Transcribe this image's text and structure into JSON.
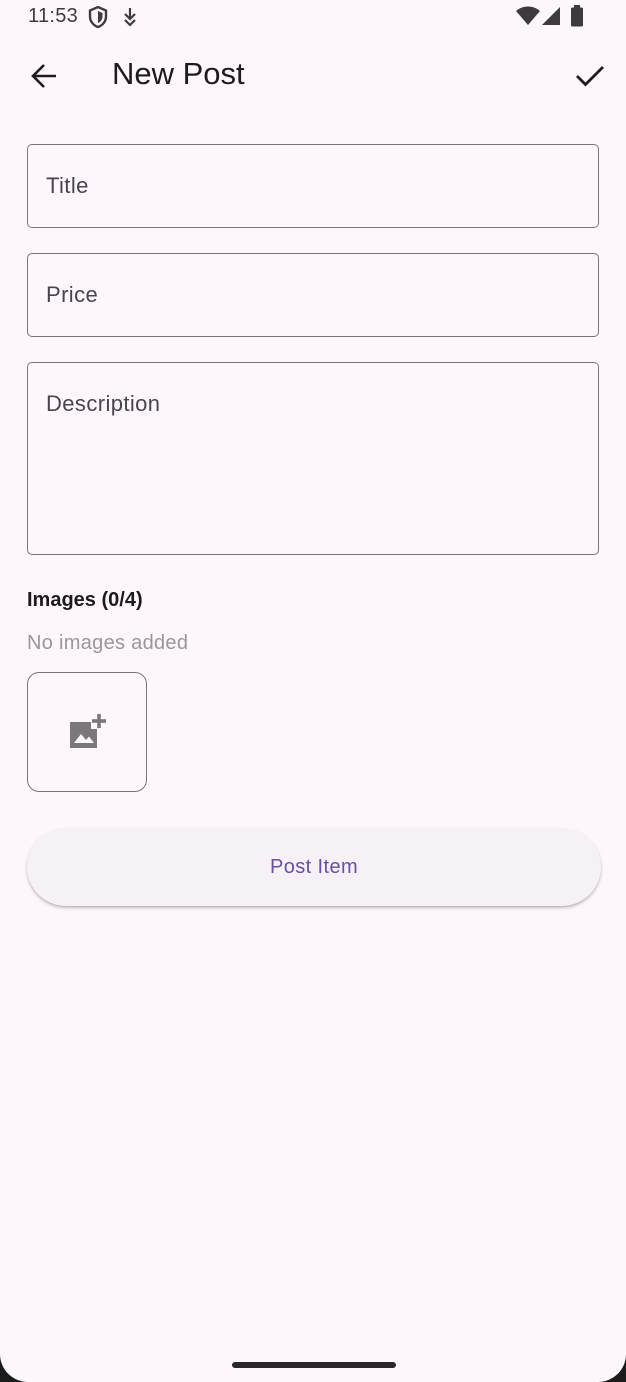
{
  "status_bar": {
    "time": "11:53",
    "icons": [
      "shield-icon",
      "download-arrow-icon",
      "wifi-icon",
      "signal-icon",
      "battery-icon"
    ]
  },
  "app_bar": {
    "title": "New Post",
    "back_icon": "arrow-back-icon",
    "confirm_icon": "check-icon"
  },
  "form": {
    "title_placeholder": "Title",
    "title_value": "",
    "price_placeholder": "Price",
    "price_value": "",
    "description_placeholder": "Description",
    "description_value": ""
  },
  "images": {
    "heading": "Images (0/4)",
    "empty_text": "No images added",
    "add_icon": "add-photo-icon"
  },
  "actions": {
    "post_label": "Post Item"
  },
  "colors": {
    "background": "#fdf7fc",
    "outline": "#79747e",
    "primary": "#6750a4",
    "button_surface": "#f6f1f6",
    "hint_text": "#9a979c"
  }
}
